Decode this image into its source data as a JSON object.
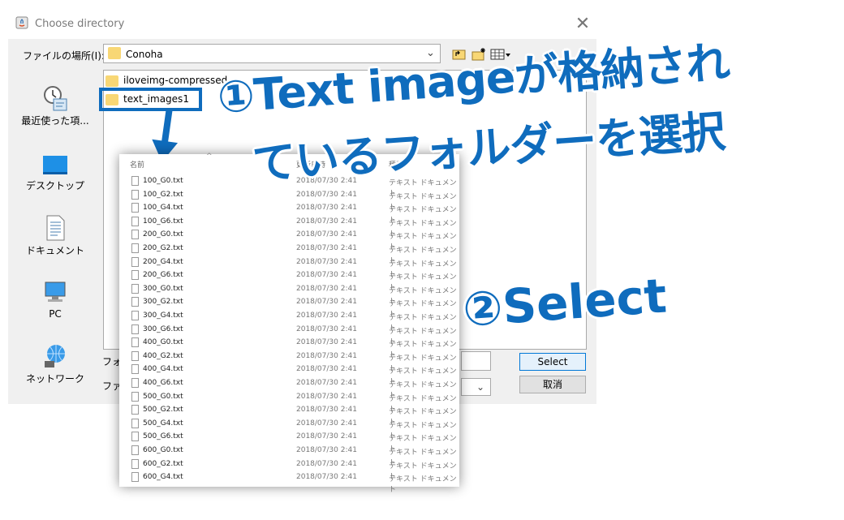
{
  "window": {
    "title": "Choose directory",
    "close_glyph": "✕"
  },
  "lookin": {
    "label": "ファイルの場所(I):",
    "value": "Conoha"
  },
  "places": [
    {
      "label": "最近使った項...",
      "icon": "recent-items-icon"
    },
    {
      "label": "デスクトップ",
      "icon": "desktop-icon"
    },
    {
      "label": "ドキュメント",
      "icon": "documents-icon"
    },
    {
      "label": "PC",
      "icon": "pc-icon"
    },
    {
      "label": "ネットワーク",
      "icon": "network-icon"
    }
  ],
  "folders": [
    {
      "name": "iloveimg-compressed"
    },
    {
      "name": "text_images1"
    }
  ],
  "bottom": {
    "foldername_label": "フォ",
    "filetype_label": "ファ",
    "select_label": "Select",
    "cancel_label": "取消"
  },
  "overlay": {
    "columns": {
      "name": "名前",
      "date": "更新日時",
      "type": "種類"
    },
    "files": [
      {
        "name": "100_G0.txt",
        "date": "2018/07/30 2:41",
        "type": "テキスト ドキュメント"
      },
      {
        "name": "100_G2.txt",
        "date": "2018/07/30 2:41",
        "type": "テキスト ドキュメント"
      },
      {
        "name": "100_G4.txt",
        "date": "2018/07/30 2:41",
        "type": "テキスト ドキュメント"
      },
      {
        "name": "100_G6.txt",
        "date": "2018/07/30 2:41",
        "type": "テキスト ドキュメント"
      },
      {
        "name": "200_G0.txt",
        "date": "2018/07/30 2:41",
        "type": "テキスト ドキュメント"
      },
      {
        "name": "200_G2.txt",
        "date": "2018/07/30 2:41",
        "type": "テキスト ドキュメント"
      },
      {
        "name": "200_G4.txt",
        "date": "2018/07/30 2:41",
        "type": "テキスト ドキュメント"
      },
      {
        "name": "200_G6.txt",
        "date": "2018/07/30 2:41",
        "type": "テキスト ドキュメント"
      },
      {
        "name": "300_G0.txt",
        "date": "2018/07/30 2:41",
        "type": "テキスト ドキュメント"
      },
      {
        "name": "300_G2.txt",
        "date": "2018/07/30 2:41",
        "type": "テキスト ドキュメント"
      },
      {
        "name": "300_G4.txt",
        "date": "2018/07/30 2:41",
        "type": "テキスト ドキュメント"
      },
      {
        "name": "300_G6.txt",
        "date": "2018/07/30 2:41",
        "type": "テキスト ドキュメント"
      },
      {
        "name": "400_G0.txt",
        "date": "2018/07/30 2:41",
        "type": "テキスト ドキュメント"
      },
      {
        "name": "400_G2.txt",
        "date": "2018/07/30 2:41",
        "type": "テキスト ドキュメント"
      },
      {
        "name": "400_G4.txt",
        "date": "2018/07/30 2:41",
        "type": "テキスト ドキュメント"
      },
      {
        "name": "400_G6.txt",
        "date": "2018/07/30 2:41",
        "type": "テキスト ドキュメント"
      },
      {
        "name": "500_G0.txt",
        "date": "2018/07/30 2:41",
        "type": "テキスト ドキュメント"
      },
      {
        "name": "500_G2.txt",
        "date": "2018/07/30 2:41",
        "type": "テキスト ドキュメント"
      },
      {
        "name": "500_G4.txt",
        "date": "2018/07/30 2:41",
        "type": "テキスト ドキュメント"
      },
      {
        "name": "500_G6.txt",
        "date": "2018/07/30 2:41",
        "type": "テキスト ドキュメント"
      },
      {
        "name": "600_G0.txt",
        "date": "2018/07/30 2:41",
        "type": "テキスト ドキュメント"
      },
      {
        "name": "600_G2.txt",
        "date": "2018/07/30 2:41",
        "type": "テキスト ドキュメント"
      },
      {
        "name": "600_G4.txt",
        "date": "2018/07/30 2:41",
        "type": "テキスト ドキュメント"
      }
    ]
  },
  "annotations": {
    "step1_line1": "①Text imageが格納され",
    "step1_line2": "ているフォルダーを選択",
    "step2": "②Select"
  },
  "colors": {
    "annotation_blue": "#0f6cbd",
    "folder_yellow": "#f8d775",
    "select_border": "#0078d7"
  }
}
